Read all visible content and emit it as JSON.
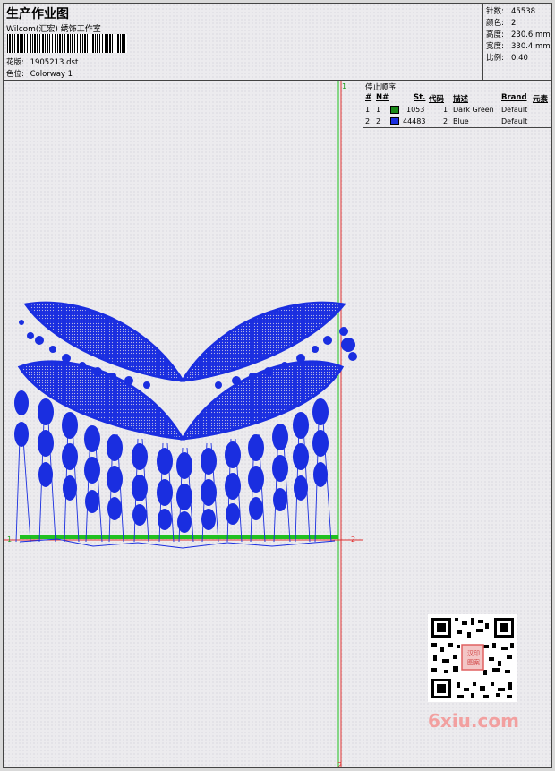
{
  "header": {
    "title": "生产作业图",
    "company": "Wilcom(汇宏) 绣饰工作室",
    "pattern_label": "花版:",
    "pattern_value": "1905213.dst",
    "colorway_label": "色位:",
    "colorway_value": "Colorway 1"
  },
  "stats": [
    {
      "label": "针数:",
      "value": "45538"
    },
    {
      "label": "颜色:",
      "value": "2"
    },
    {
      "label": "高度:",
      "value": "230.6 mm"
    },
    {
      "label": "宽度:",
      "value": "330.4 mm"
    },
    {
      "label": "比例:",
      "value": "0.40"
    }
  ],
  "stop_sequence": {
    "title": "停止顺序:",
    "columns": [
      "#",
      "N#",
      "St.",
      "代码",
      "描述",
      "Brand",
      "元素"
    ],
    "rows": [
      {
        "num": "1.",
        "n": "1",
        "color": "#1a8a1a",
        "st": "1053",
        "code": "1",
        "desc": "Dark Green",
        "brand": "Default"
      },
      {
        "num": "2.",
        "n": "2",
        "color": "#1a2ee0",
        "st": "44483",
        "code": "2",
        "desc": "Blue",
        "brand": "Default"
      }
    ]
  },
  "markers": {
    "top_1": "1",
    "bottom_2": "2",
    "left_1": "1",
    "right_2": "2"
  },
  "watermark": {
    "text": "6xiu.com",
    "seal": "汉印图案"
  },
  "colors": {
    "thread_blue": "#1a2ee0",
    "thread_green": "#1a8a1a",
    "guide_red": "#e03030",
    "guide_green": "#20c020"
  }
}
